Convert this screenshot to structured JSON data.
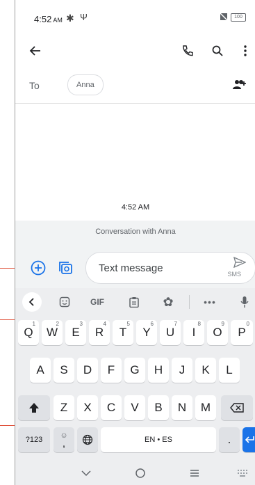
{
  "status_bar": {
    "time": "4:52",
    "ampm": "AM",
    "battery": "100"
  },
  "app_bar": {
    "back_icon": "arrow-left-icon",
    "call_icon": "phone-icon",
    "search_icon": "search-icon",
    "more_icon": "more-vert-icon"
  },
  "recipient": {
    "to_label": "To",
    "chip": "Anna",
    "add_icon": "add-people-icon"
  },
  "conversation": {
    "timestamp": "4:52 AM",
    "banner": "Conversation with Anna"
  },
  "compose": {
    "placeholder": "Text message",
    "send_label": "SMS",
    "attach_icon": "add-circle-icon",
    "gallery_icon": "gallery-camera-icon"
  },
  "keyboard": {
    "toolbar": [
      "back-chevron-icon",
      "sticker-icon",
      "GIF",
      "clipboard-icon",
      "settings-icon",
      "more-icon",
      "mic-icon"
    ],
    "row1": [
      {
        "k": "Q",
        "h": "1"
      },
      {
        "k": "W",
        "h": "2"
      },
      {
        "k": "E",
        "h": "3"
      },
      {
        "k": "R",
        "h": "4"
      },
      {
        "k": "T",
        "h": "5"
      },
      {
        "k": "Y",
        "h": "6"
      },
      {
        "k": "U",
        "h": "7"
      },
      {
        "k": "I",
        "h": "8"
      },
      {
        "k": "O",
        "h": "9"
      },
      {
        "k": "P",
        "h": "0"
      }
    ],
    "row2": [
      "A",
      "S",
      "D",
      "F",
      "G",
      "H",
      "J",
      "K",
      "L"
    ],
    "row3": [
      "Z",
      "X",
      "C",
      "V",
      "B",
      "N",
      "M"
    ],
    "symbols": "?123",
    "emoji_comma": ",",
    "space": "EN • ES",
    "period": "."
  },
  "colors": {
    "accent": "#1a73e8",
    "callout": "#e0533c"
  }
}
